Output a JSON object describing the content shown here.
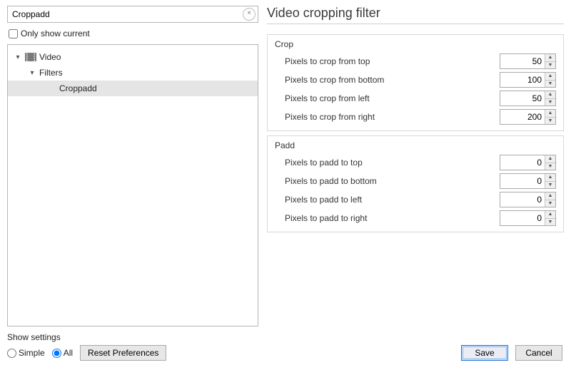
{
  "search": {
    "value": "Croppadd"
  },
  "only_show_current": {
    "label": "Only show current",
    "checked": false
  },
  "tree": {
    "video": "Video",
    "filters": "Filters",
    "croppadd": "Croppadd"
  },
  "show_settings": {
    "label": "Show settings",
    "simple": "Simple",
    "all": "All",
    "selected": "all"
  },
  "reset_btn": "Reset Preferences",
  "title": "Video cropping filter",
  "groups": {
    "crop": {
      "title": "Crop",
      "top": {
        "label": "Pixels to crop from top",
        "value": 50
      },
      "bottom": {
        "label": "Pixels to crop from bottom",
        "value": 100
      },
      "left": {
        "label": "Pixels to crop from left",
        "value": 50
      },
      "right": {
        "label": "Pixels to crop from right",
        "value": 200
      }
    },
    "padd": {
      "title": "Padd",
      "top": {
        "label": "Pixels to padd to top",
        "value": 0
      },
      "bottom": {
        "label": "Pixels to padd to bottom",
        "value": 0
      },
      "left": {
        "label": "Pixels to padd to left",
        "value": 0
      },
      "right": {
        "label": "Pixels to padd to right",
        "value": 0
      }
    }
  },
  "buttons": {
    "save": "Save",
    "cancel": "Cancel"
  }
}
